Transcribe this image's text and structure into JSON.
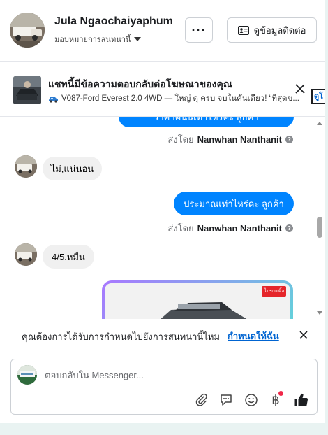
{
  "header": {
    "contact_name": "Jula Ngaochaiyaphum",
    "assign_label": "มอบหมายการสนทนานี้",
    "more_label": "···",
    "contact_info_label": "ดูข้อมูลติดต่อ"
  },
  "ad_banner": {
    "title": "แชทนี้มีข้อความตอบกลับต่อโฆษณาของคุณ",
    "subtitle": "V087-Ford Everest 2.0 4WD — ใหญ่ ดุ ครบ จบในคันเดียว! “ที่สุดข...",
    "side_link": "ดูโ"
  },
  "messages": [
    {
      "direction": "out",
      "text": "ราคาคันนี้เท่าไหร่คะ ลูกค้า"
    },
    {
      "direction": "meta",
      "sent_by_prefix": "ส่งโดย",
      "sent_by_name": "Nanwhan Nanthanit"
    },
    {
      "direction": "in",
      "text": "ไม่,แน่นอน"
    },
    {
      "direction": "out",
      "text": "ประมาณเท่าไหร่คะ  ลูกค้า"
    },
    {
      "direction": "meta",
      "sent_by_prefix": "ส่งโดย",
      "sent_by_name": "Nanwhan Nanthanit"
    },
    {
      "direction": "in",
      "text": "4/5.หมื่น"
    },
    {
      "direction": "in",
      "type": "image",
      "badge": "ไปขายดิ้ง"
    }
  ],
  "assign_prompt": {
    "question": "คุณต้องการได้รับการกำหนดไปยังการสนทนานี้ไหม",
    "link": "กำหนดให้ฉัน"
  },
  "composer": {
    "placeholder": "ตอบกลับใน Messenger...",
    "tools": [
      "paperclip-icon",
      "speech-bubble-icon",
      "smiley-icon",
      "baht-icon",
      "thumbs-up-icon"
    ],
    "baht_symbol": "฿"
  },
  "colors": {
    "outgoing_bubble": "#0084ff",
    "incoming_bubble": "#f0f0f0",
    "link": "#0064d1",
    "notification_dot": "#f02849"
  }
}
